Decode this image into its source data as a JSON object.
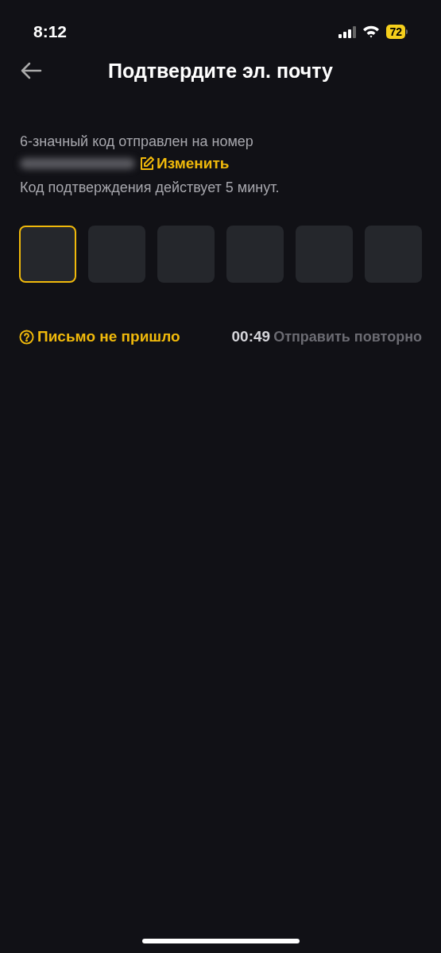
{
  "status_bar": {
    "time": "8:12",
    "battery": "72"
  },
  "header": {
    "title": "Подтвердите эл. почту"
  },
  "info": {
    "sent_text": "6-значный код отправлен на номер",
    "change_link": "Изменить",
    "validity_text": "Код подтверждения действует 5 минут."
  },
  "code_boxes": [
    {
      "selected": true
    },
    {
      "selected": false
    },
    {
      "selected": false
    },
    {
      "selected": false
    },
    {
      "selected": false
    },
    {
      "selected": false
    }
  ],
  "footer": {
    "help_link": "Письмо не пришло",
    "timer": "00:49",
    "resend": "Отправить повторно",
    "resend_disabled": true
  }
}
